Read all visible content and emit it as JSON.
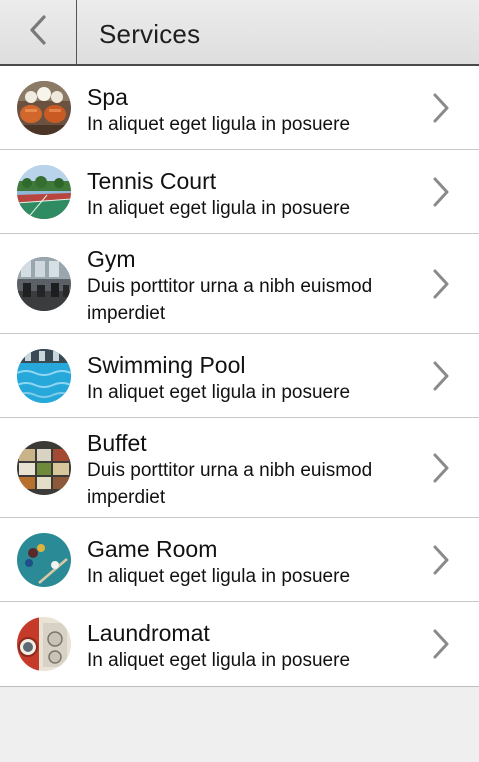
{
  "header": {
    "title": "Services",
    "back_icon": "chevron-left-icon"
  },
  "colors": {
    "header_bg": "#e4e4e4",
    "row_bg": "#ffffff",
    "footer_bg": "#efefef",
    "chevron": "#8a8a8a"
  },
  "services": [
    {
      "name": "Spa",
      "description": "In aliquet eget ligula in posuere",
      "icon": "spa-thumbnail"
    },
    {
      "name": "Tennis Court",
      "description": "In aliquet eget ligula in posuere",
      "icon": "tennis-court-thumbnail"
    },
    {
      "name": "Gym",
      "description": "Duis porttitor urna a nibh euismod imperdiet",
      "icon": "gym-thumbnail"
    },
    {
      "name": "Swimming Pool",
      "description": "In aliquet eget ligula in posuere",
      "icon": "swimming-pool-thumbnail"
    },
    {
      "name": "Buffet",
      "description": "Duis porttitor urna a nibh euismod imperdiet",
      "icon": "buffet-thumbnail"
    },
    {
      "name": "Game Room",
      "description": "In aliquet eget ligula in posuere",
      "icon": "game-room-thumbnail"
    },
    {
      "name": "Laundromat",
      "description": "In aliquet eget ligula in posuere",
      "icon": "laundromat-thumbnail"
    }
  ]
}
